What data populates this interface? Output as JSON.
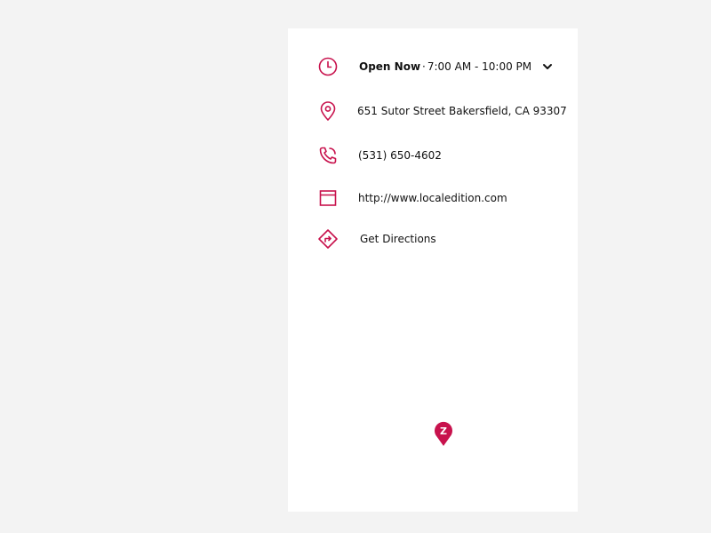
{
  "colors": {
    "accent": "#c8124d",
    "text": "#111111",
    "page_background": "#f3f3f3",
    "panel_background": "#ffffff"
  },
  "hours": {
    "icon": "clock-icon",
    "status": "Open Now",
    "separator": "·",
    "range": "7:00 AM - 10:00 PM",
    "toggle_icon": "chevron-down-icon"
  },
  "address": {
    "icon": "location-pin-icon",
    "text": "651 Sutor Street Bakersfield, CA 93307"
  },
  "phone": {
    "icon": "phone-icon",
    "text": "(531) 650-4602"
  },
  "website": {
    "icon": "browser-window-icon",
    "text": "http://www.localedition.com"
  },
  "directions": {
    "icon": "directions-sign-icon",
    "text": "Get Directions"
  },
  "map": {
    "marker_icon": "map-marker-icon",
    "marker_letter": "Z"
  }
}
